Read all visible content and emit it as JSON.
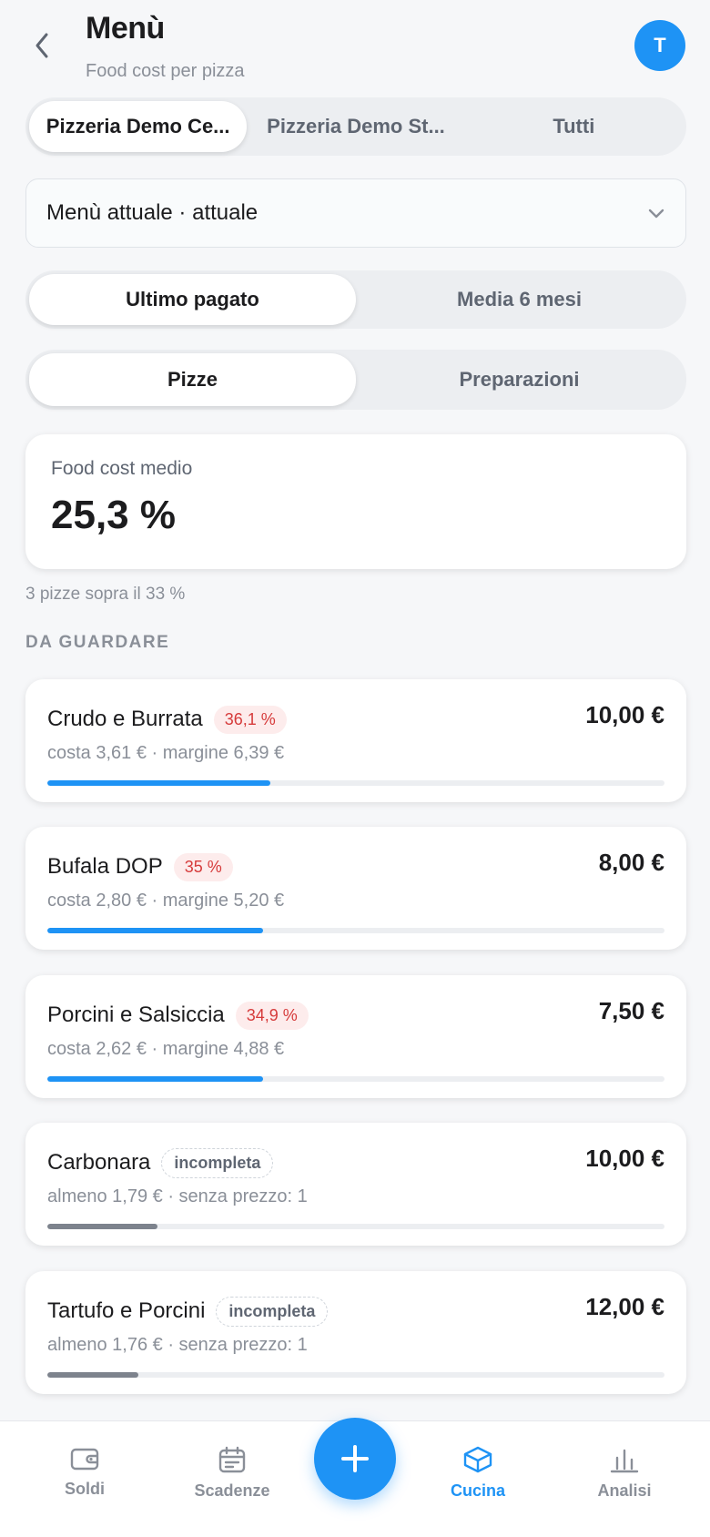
{
  "header": {
    "title": "Menù",
    "subtitle": "Food cost per pizza",
    "avatar_initial": "T"
  },
  "store_tabs": [
    {
      "label": "Pizzeria Demo Ce...",
      "active": true
    },
    {
      "label": "Pizzeria Demo St...",
      "active": false
    },
    {
      "label": "Tutti",
      "active": false
    }
  ],
  "menu_select": {
    "value": "Menù attuale · attuale"
  },
  "price_tabs": [
    {
      "label": "Ultimo pagato",
      "active": true
    },
    {
      "label": "Media 6 mesi",
      "active": false
    }
  ],
  "type_tabs": [
    {
      "label": "Pizze",
      "active": true
    },
    {
      "label": "Preparazioni",
      "active": false
    }
  ],
  "summary": {
    "label": "Food cost medio",
    "value": "25,3 %"
  },
  "note": "3 pizze sopra il 33 %",
  "section_title": "DA GUARDARE",
  "pizzas": [
    {
      "name": "Crudo e Burrata",
      "badge": "36,1 %",
      "badge_type": "red",
      "price": "10,00 €",
      "meta": "costa 3,61 € · margine 6,39 €",
      "bar_fraction": 0.361,
      "bar_color": "blue"
    },
    {
      "name": "Bufala DOP",
      "badge": "35 %",
      "badge_type": "red",
      "price": "8,00 €",
      "meta": "costa 2,80 € · margine 5,20 €",
      "bar_fraction": 0.35,
      "bar_color": "blue"
    },
    {
      "name": "Porcini e Salsiccia",
      "badge": "34,9 %",
      "badge_type": "red",
      "price": "7,50 €",
      "meta": "costa 2,62 € · margine 4,88 €",
      "bar_fraction": 0.349,
      "bar_color": "blue"
    },
    {
      "name": "Carbonara",
      "badge": "incompleta",
      "badge_type": "incomplete",
      "price": "10,00 €",
      "meta": "almeno 1,79 € · senza prezzo: 1",
      "bar_fraction": 0.179,
      "bar_color": "grey"
    },
    {
      "name": "Tartufo e Porcini",
      "badge": "incompleta",
      "badge_type": "incomplete",
      "price": "12,00 €",
      "meta": "almeno 1,76 € · senza prezzo: 1",
      "bar_fraction": 0.147,
      "bar_color": "grey"
    }
  ],
  "nav": [
    {
      "label": "Soldi",
      "icon": "wallet-icon",
      "active": false
    },
    {
      "label": "Scadenze",
      "icon": "calendar-icon",
      "active": false
    },
    {
      "label": "Cucina",
      "icon": "box-icon",
      "active": true
    },
    {
      "label": "Analisi",
      "icon": "bar-chart-icon",
      "active": false
    }
  ],
  "colors": {
    "accent": "#1e93f5",
    "danger": "#d63b3b",
    "muted": "#8a8f98"
  }
}
